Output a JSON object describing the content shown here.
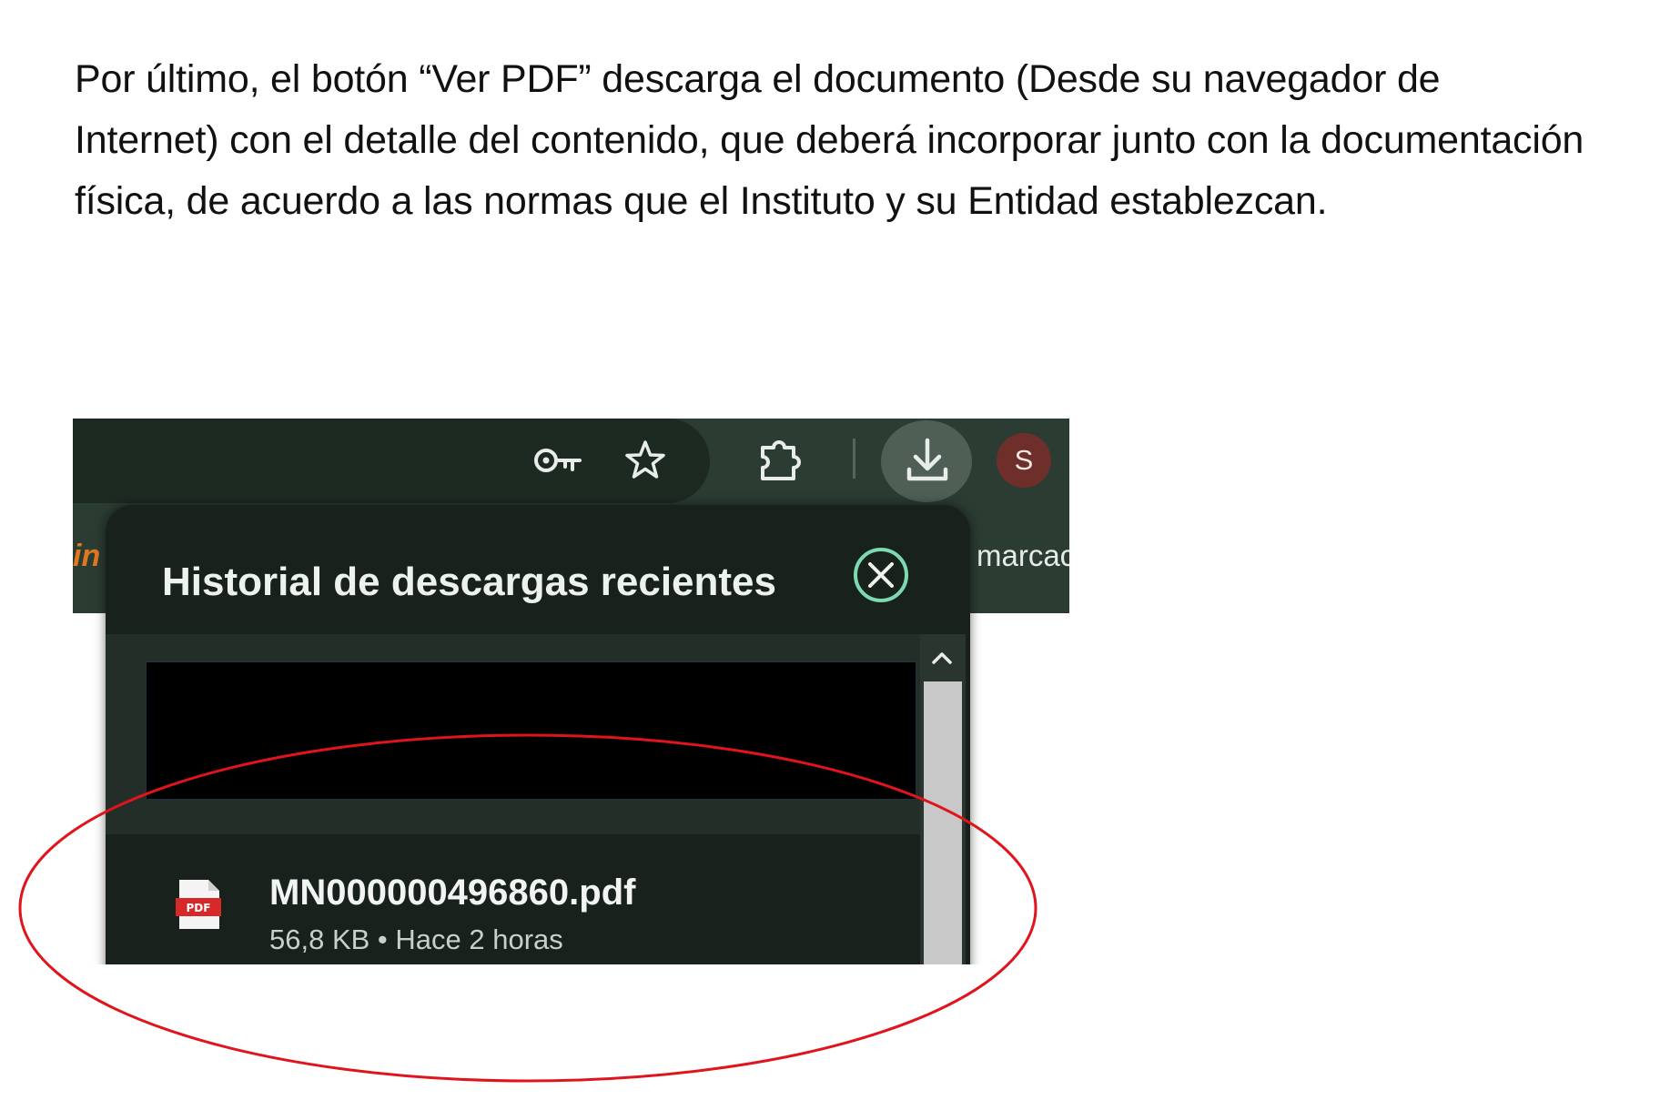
{
  "document": {
    "paragraph": "Por último, el botón “Ver PDF” descarga el documento (Desde su navegador de Internet) con el detalle del contenido, que deberá incorporar junto con la documentación física, de acuerdo a las normas que el Instituto y su Entidad establezcan."
  },
  "browser": {
    "profile_initial": "S",
    "bookmark_favicon_text": "in",
    "bookmark_label": "marcac",
    "icons": [
      "key-icon",
      "star-icon",
      "puzzle-icon",
      "download-icon"
    ],
    "colors": {
      "toolbar": "#2b3c32",
      "panel": "#18211c",
      "close_accent": "#7fd9b0",
      "annotation": "#e0141c"
    }
  },
  "downloads_panel": {
    "title": "Historial de descargas recientes",
    "items": [
      {
        "file_name": "MN000000496860.pdf",
        "meta": "56,8 KB • Hace 2 horas",
        "icon_label": "PDF"
      }
    ]
  }
}
